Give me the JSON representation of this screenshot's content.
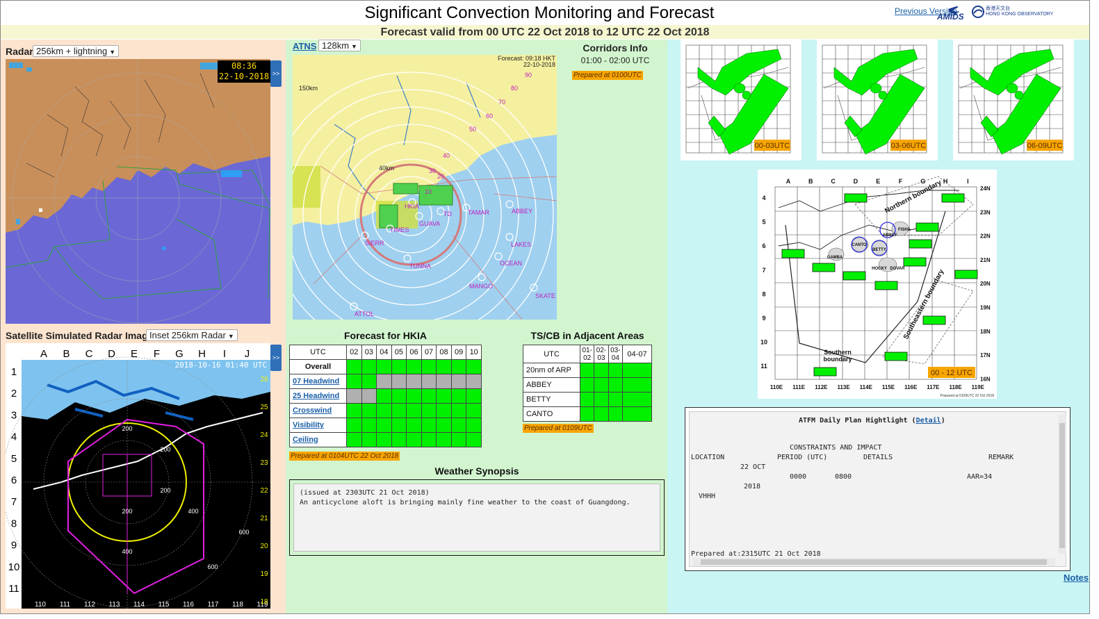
{
  "header": {
    "title": "Significant Convection Monitoring and Forecast",
    "previous_link": "Previous Version",
    "amids_logo": "AMIDS",
    "hko_logo_line1": "香港天文台",
    "hko_logo_line2": "HONG KONG OBSERVATORY",
    "subtitle": "Forecast valid from 00 UTC 22 Oct 2018 to 12 UTC 22 Oct 2018"
  },
  "radar": {
    "label": "Radar",
    "select_value": "256km + lightning",
    "stamp_time": "08:36",
    "stamp_date": "22-10-2018",
    "expand": ">>"
  },
  "satellite": {
    "label": "Satellite Simulated Radar Image",
    "select_value": "Inset 256km Radar",
    "expand": ">>",
    "timestamp": "2018-10-16 01:40 UTC",
    "col_letters": [
      "A",
      "B",
      "C",
      "D",
      "E",
      "F",
      "G",
      "H",
      "I",
      "J"
    ],
    "row_numbers": [
      "1",
      "2",
      "3",
      "4",
      "5",
      "6",
      "7",
      "8",
      "9",
      "10",
      "11"
    ],
    "lon_labels": [
      "110",
      "111",
      "112",
      "113",
      "114",
      "115",
      "116",
      "117",
      "118",
      "119"
    ],
    "lat_labels": [
      "26",
      "25",
      "24",
      "23",
      "22",
      "21",
      "20",
      "19",
      "18"
    ],
    "range_labels": [
      "200",
      "200",
      "200",
      "200",
      "400",
      "400",
      "600",
      "600"
    ]
  },
  "atns": {
    "link": "ATNS",
    "select_value": "128km",
    "forecast_label": "Forecast: 09:18 HKT",
    "forecast_date": "22-10-2018",
    "range_150": "150km",
    "range_40": "40km",
    "ring_labels": [
      "90",
      "80",
      "70",
      "60",
      "50",
      "40",
      "30",
      "20",
      "10"
    ],
    "points": [
      "HKIA",
      "TD",
      "GUAVA",
      "TAMAR",
      "ABBEY",
      "LAKES",
      "OCEAN",
      "SIERR",
      "TUNNA",
      "MANGO",
      "SKATE",
      "ATTOL",
      "TIMES"
    ]
  },
  "corridors": {
    "title": "Corridors Info",
    "time": "01:00 - 02:00 UTC",
    "prepared": "Prepared at 0100UTC"
  },
  "hkia": {
    "title": "Forecast for HKIA",
    "utc_label": "UTC",
    "hours": [
      "02",
      "03",
      "04",
      "05",
      "06",
      "07",
      "08",
      "09",
      "10"
    ],
    "rows": [
      {
        "label": "Overall",
        "cells": [
          "g",
          "g",
          "g",
          "g",
          "g",
          "g",
          "g",
          "g",
          "g"
        ]
      },
      {
        "label": "07 Headwind",
        "cells": [
          "g",
          "g",
          "y",
          "y",
          "y",
          "y",
          "y",
          "y",
          "y"
        ]
      },
      {
        "label": "25 Headwind",
        "cells": [
          "y",
          "y",
          "g",
          "g",
          "g",
          "g",
          "g",
          "g",
          "g"
        ]
      },
      {
        "label": "Crosswind",
        "cells": [
          "g",
          "g",
          "g",
          "g",
          "g",
          "g",
          "g",
          "g",
          "g"
        ]
      },
      {
        "label": "Visibility",
        "cells": [
          "g",
          "g",
          "g",
          "g",
          "g",
          "g",
          "g",
          "g",
          "g"
        ]
      },
      {
        "label": "Ceiling",
        "cells": [
          "g",
          "g",
          "g",
          "g",
          "g",
          "g",
          "g",
          "g",
          "g"
        ]
      }
    ],
    "prepared": "Prepared at 0104UTC 22 Oct 2018"
  },
  "tscb": {
    "title": "TS/CB in Adjacent Areas",
    "utc_label": "UTC",
    "col1_top": "01-",
    "col1_bot": "02",
    "col2_top": "02-",
    "col2_bot": "03",
    "col3_top": "03-",
    "col3_bot": "04",
    "col4": "04-07",
    "rows": [
      {
        "label": "20nm of ARP"
      },
      {
        "label": "ABBEY"
      },
      {
        "label": "BETTY"
      },
      {
        "label": "CANTO"
      }
    ],
    "prepared": "Prepared at 0109UTC"
  },
  "synopsis": {
    "title": "Weather Synopsis",
    "issued": "(issued at 2303UTC 21 Oct 2018)",
    "text": "An anticyclone aloft is bringing mainly fine weather to the coast of Guangdong."
  },
  "mini_maps": [
    {
      "label": "00-03UTC"
    },
    {
      "label": "03-06UTC"
    },
    {
      "label": "06-09UTC"
    }
  ],
  "big_map": {
    "col_letters": [
      "A",
      "B",
      "C",
      "D",
      "E",
      "F",
      "G",
      "H",
      "I"
    ],
    "row_numbers": [
      "4",
      "5",
      "6",
      "7",
      "8",
      "9",
      "10",
      "11"
    ],
    "lon_labels": [
      "110E",
      "111E",
      "112E",
      "113E",
      "114E",
      "115E",
      "116E",
      "117E",
      "118E",
      "119E"
    ],
    "lat_labels": [
      "24N",
      "23N",
      "22N",
      "21N",
      "20N",
      "19N",
      "18N",
      "17N",
      "16N"
    ],
    "north_boundary": "Northern boundary",
    "se_boundary": "Southeastern boundary",
    "s_boundary_1": "Southern",
    "s_boundary_2": "boundary",
    "points": [
      "FISHA",
      "ABBEY",
      "CANTO",
      "BETTY",
      "GAMBA",
      "HOCKY",
      "DOVAR"
    ],
    "period": "00 - 12 UTC",
    "prepared": "Prepared at 0109UTC 22 Oct 2018"
  },
  "atfm": {
    "title": "ATFM Daily Plan Hightlight (",
    "detail_link": "Detail",
    "title_end": ")",
    "constraints_header": "CONSTRAINTS AND IMPACT",
    "col_location": "LOCATION",
    "col_period": "PERIOD (UTC)",
    "col_details": "DETAILS",
    "col_remark": "REMARK",
    "date_line1": "22 OCT",
    "date_line2": "2018",
    "start": "0000",
    "end": "0800",
    "remark_value": "AAR=34",
    "location_value": "VHHH",
    "prepared": "Prepared at:2315UTC 21 Oct 2018"
  },
  "footer": {
    "notes_link": "Notes"
  },
  "colors": {
    "green_cell": "#00f000",
    "grey_cell": "#b0b0b0",
    "prepared_tag": "#f7a500",
    "link": "#1a5fa8",
    "panel_left": "#fde4cf",
    "panel_mid": "#d2f5cf",
    "panel_right": "#c9f5f5"
  }
}
